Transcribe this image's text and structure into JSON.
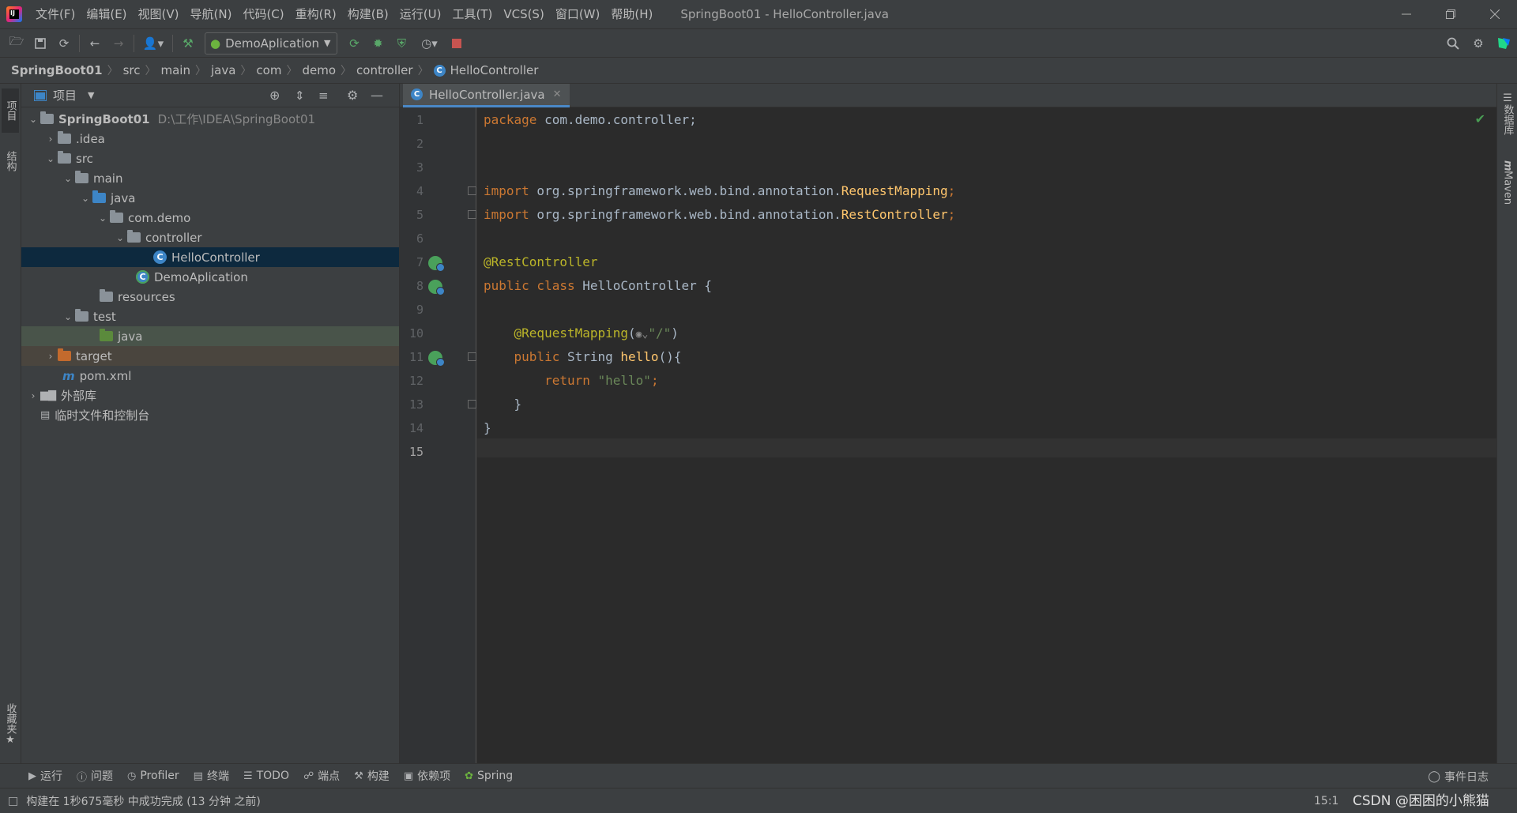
{
  "titlebar": {
    "menus": [
      "文件(F)",
      "编辑(E)",
      "视图(V)",
      "导航(N)",
      "代码(C)",
      "重构(R)",
      "构建(B)",
      "运行(U)",
      "工具(T)",
      "VCS(S)",
      "窗口(W)",
      "帮助(H)"
    ],
    "window_title": "SpringBoot01 - HelloController.java"
  },
  "toolbar": {
    "run_config": "DemoAplication"
  },
  "breadcrumb": [
    "SpringBoot01",
    "src",
    "main",
    "java",
    "com",
    "demo",
    "controller",
    "HelloController"
  ],
  "left_stripe": {
    "project": "项目",
    "structure": "结构",
    "favorites": "收藏夹"
  },
  "right_stripe": {
    "database": "数据库",
    "maven": "Maven"
  },
  "project_panel": {
    "title": "项目",
    "root_name": "SpringBoot01",
    "root_path": "D:\\工作\\IDEA\\SpringBoot01",
    "items": {
      "idea": ".idea",
      "src": "src",
      "main": "main",
      "java": "java",
      "com_demo": "com.demo",
      "controller": "controller",
      "hello_controller": "HelloController",
      "demo_aplication": "DemoAplication",
      "resources": "resources",
      "test": "test",
      "test_java": "java",
      "target": "target",
      "pom": "pom.xml",
      "external_libs": "外部库",
      "scratches": "临时文件和控制台"
    }
  },
  "editor": {
    "tab_label": "HelloController.java",
    "line_numbers": [
      "1",
      "2",
      "3",
      "4",
      "5",
      "6",
      "7",
      "8",
      "9",
      "10",
      "11",
      "12",
      "13",
      "14",
      "15"
    ],
    "code": {
      "l1_kw": "package",
      "l1_rest": " com.demo.controller;",
      "l4_kw": "import",
      "l4_pkg": " org.springframework.web.bind.annotation.",
      "l4_cls": "RequestMapping",
      "l4_end": ";",
      "l5_kw": "import",
      "l5_pkg": " org.springframework.web.bind.annotation.",
      "l5_cls": "RestController",
      "l5_end": ";",
      "l7_ann": "@RestController",
      "l8_kw": "public class",
      "l8_rest": " HelloController {",
      "l10_ann": "@RequestMapping",
      "l10_open": "(",
      "l10_str": "\"/\"",
      "l10_close": ")",
      "l11_kw": "public",
      "l11_type": " String ",
      "l11_fn": "hello",
      "l11_rest": "(){",
      "l12_kw": "return",
      "l12_str": "\"hello\"",
      "l12_end": ";",
      "l13": "}",
      "l14": "}"
    }
  },
  "bottom_tools": [
    "运行",
    "问题",
    "Profiler",
    "终端",
    "TODO",
    "端点",
    "构建",
    "依赖项",
    "Spring"
  ],
  "event_log": "事件日志",
  "status": {
    "message": "构建在 1秒675毫秒 中成功完成 (13 分钟 之前)",
    "caret": "15:1",
    "watermark": "CSDN @困困的小熊猫"
  },
  "colors": {
    "accent": "#4a88c7",
    "keyword": "#cc7832",
    "annotation": "#bbb529",
    "string": "#6a8759",
    "function": "#ffc66d"
  }
}
